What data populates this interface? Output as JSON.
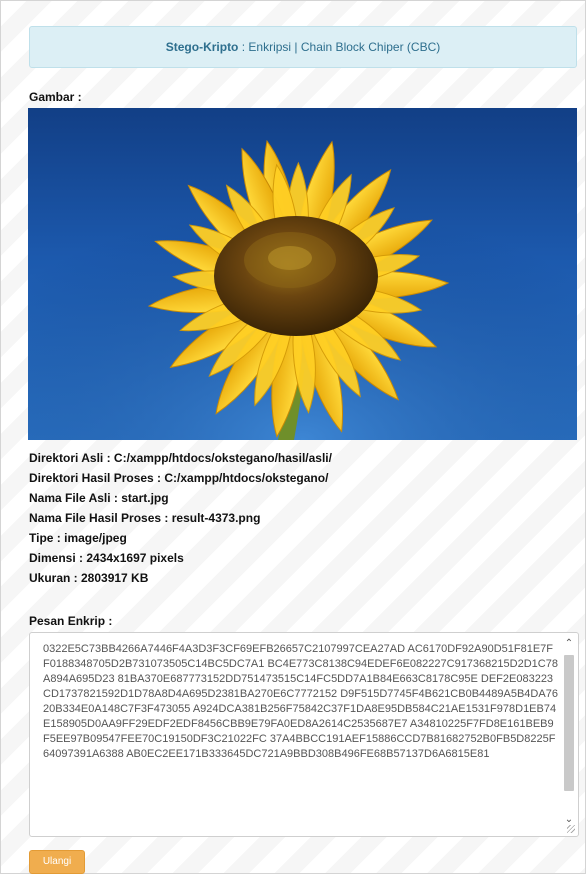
{
  "header": {
    "app_name": "Stego-Kripto",
    "separator": " : ",
    "mode": "Enkripsi | Chain Block Chiper (CBC)"
  },
  "image_section": {
    "label": "Gambar :",
    "image_description": "sunflower-photo"
  },
  "info": {
    "lines": [
      "Direktori Asli : C:/xampp/htdocs/okstegano/hasil/asli/",
      "Direktori Hasil Proses : C:/xampp/htdocs/okstegano/",
      "Nama File Asli : start.jpg",
      "Nama File Hasil Proses : result-4373.png",
      "Tipe : image/jpeg",
      "Dimensi : 2434x1697 pixels",
      "Ukuran : 2803917 KB"
    ]
  },
  "message": {
    "label": "Pesan Enkrip :",
    "value": "0322E5C73BB4266A7446F4A3D3F3CF69EFB26657C2107997CEA27AD AC6170DF92A90D51F81E7FF0188348705D2B731073505C14BC5DC7A1 BC4E773C8138C94EDEF6E082227C917368215D2D1C78A894A695D23 81BA370E687773152DD751473515C14FC5DD7A1B84E663C8178C95E DEF2E083223CD1737821592D1D78A8D4A695D2381BA270E6C7772152 D9F515D7745F4B621CB0B4489A5B4DA7620B334E0A148C7F3F473055 A924DCA381B256F75842C37F1DA8E95DB584C21AE1531F978D1EB74 E158905D0AA9FF29EDF2EDF8456CBB9E79FA0ED8A2614C2535687E7 A34810225F7FD8E161BEB9F5EE97B09547FEE70C19150DF3C21022FC 37A4BBCC191AEF15886CCD7B81682752B0FB5D8225F64097391A6388 AB0EC2EE171B333645DC721A9BBD308B496FE68B57137D6A6815E81"
  },
  "actions": {
    "retry_label": "Ulangi"
  },
  "colors": {
    "header_bg": "#dceff5",
    "header_text": "#2e6f8e",
    "button_bg": "#f0ad4e",
    "sky": "#1c59ad",
    "petal": "#f5c211",
    "disc": "#5a3a0c"
  }
}
